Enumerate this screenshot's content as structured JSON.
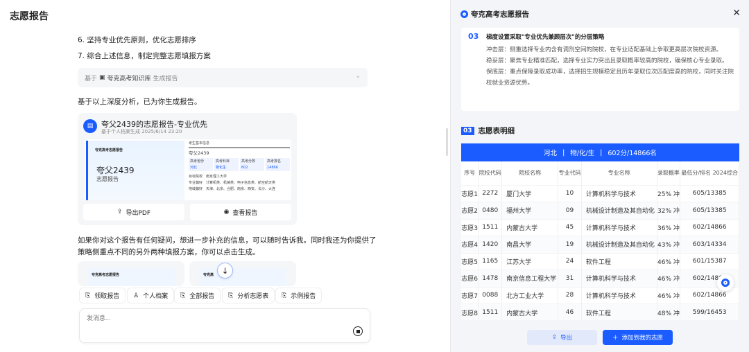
{
  "left": {
    "title": "志愿报告",
    "steps": [
      "6. 坚持专业优先原则，优化志愿排序",
      "7. 综合上述信息，制定完整志愿填报方案"
    ],
    "source": {
      "prefix": "基于",
      "kb": "夸克高考知识库",
      "suffix": "生成报告"
    },
    "intro": "基于以上深度分析，已为你生成报告。",
    "report_card": {
      "title": "夸父2439的志愿报告-专业优先",
      "subtitle": "基于个人档案生成 2025/6/14 23:20",
      "preview": {
        "brand": "夸克高考志愿报告",
        "name": "夸父2439",
        "label": "志愿报告",
        "info_title": "考生基本信息",
        "info_name": "夸父2439",
        "cells": [
          {
            "k": "高考省份",
            "v": "河北"
          },
          {
            "k": "高考科目",
            "v": "物化生"
          },
          {
            "k": "高考分数",
            "v": "602"
          },
          {
            "k": "高考排名",
            "v": "14866"
          }
        ],
        "rows": [
          {
            "k": "目标院校",
            "v": "南京理工大学"
          },
          {
            "k": "专业偏好",
            "v": "计算机类、机械类、电子信息类、航空航天类"
          },
          {
            "k": "地域偏好",
            "v": "天津、北京、合肥、南京、西安、长沙、大连"
          }
        ]
      },
      "export": "导出PDF",
      "view": "查看报告"
    },
    "followup": [
      "如果你对这个报告有任何疑问，想进一步补充的信息，可以随时告诉我。同时我还为你提供了",
      "策略侧重点不同的另外两种填报方案，你可以点击生成。"
    ],
    "mini_brand": "夸克高考志愿报告",
    "mini_brand2": "夸克高",
    "chips": [
      "领取报告",
      "个人档案",
      "全部报告",
      "分析志愿表",
      "示例报告"
    ],
    "input_placeholder": "发消息..."
  },
  "right": {
    "title": "夸克高考志愿报告",
    "strategy": {
      "num": "03",
      "heading": "梯度设置采取\"专业优先兼顾层次\"的分层策略",
      "lines": [
        "冲击层：侧重选择专业内含有调剂空间的院校，在专业适配基础上争取更高层次院校资源。",
        "稳妥层：聚焦专业精准匹配，选择专业实力突出且录取概率较高的院校，确保核心专业录取。",
        "保底层：重点保障录取成功率，选择招生规模稳定且历年录取位次匹配度高的院校，同时关注院校就业资源优势。"
      ]
    },
    "section": {
      "num": "03",
      "title": "志愿表明细"
    },
    "band": [
      "河北",
      "物/化/生",
      "602分/14866名"
    ],
    "headers": [
      "序号",
      "院校代码",
      "院校名称",
      "专业代码",
      "专业名称",
      "录取概率",
      "最低分/排名 2024综合"
    ],
    "rows": [
      [
        "志愿1",
        "2272",
        "厦门大学",
        "10",
        "计算机科学与技术",
        "25% 冲",
        "605/13385"
      ],
      [
        "志愿2",
        "0480",
        "福州大学",
        "09",
        "机械设计制造及其自动化",
        "32% 冲",
        "605/13385"
      ],
      [
        "志愿3",
        "1511",
        "内蒙古大学",
        "45",
        "计算机科学与技术",
        "36% 冲",
        "602/14866"
      ],
      [
        "志愿4",
        "1420",
        "南昌大学",
        "19",
        "机械设计制造及其自动化",
        "43% 冲",
        "603/14334"
      ],
      [
        "志愿5",
        "1165",
        "江苏大学",
        "24",
        "软件工程",
        "46% 冲",
        "601/15387"
      ],
      [
        "志愿6",
        "1478",
        "南京信息工程大学",
        "31",
        "计算机科学与技术",
        "46% 冲",
        "602/14866"
      ],
      [
        "志愿7",
        "0088",
        "北方工业大学",
        "28",
        "计算机科学与技术",
        "46% 冲",
        "602/14866"
      ],
      [
        "志愿8",
        "1511",
        "内蒙古大学",
        "46",
        "软件工程",
        "48% 冲",
        "599/16453"
      ]
    ],
    "export": "导出",
    "add": "添加到我的志愿"
  }
}
